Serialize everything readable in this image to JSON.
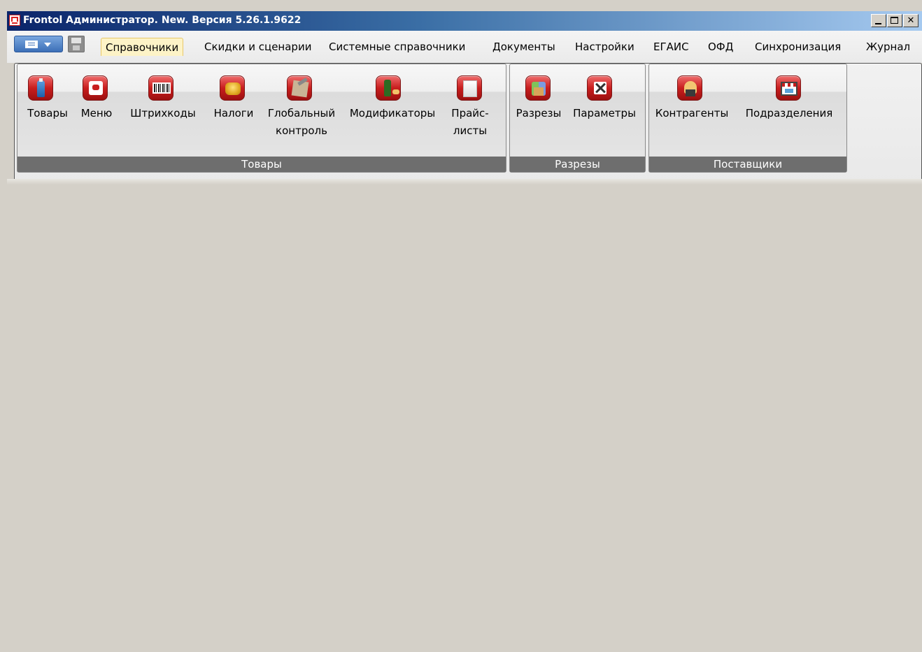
{
  "window": {
    "title": "Frontol Администратор. New. Версия 5.26.1.9622"
  },
  "menubar": {
    "tabs": [
      {
        "label": "Справочники",
        "active": true
      },
      {
        "label": "Скидки и сценарии",
        "active": false
      },
      {
        "label": "Системные справочники",
        "active": false
      },
      {
        "label": "Документы",
        "active": false
      },
      {
        "label": "Настройки",
        "active": false
      },
      {
        "label": "ЕГАИС",
        "active": false
      },
      {
        "label": "ОФД",
        "active": false
      },
      {
        "label": "Синхронизация",
        "active": false
      },
      {
        "label": "Журнал",
        "active": false
      }
    ]
  },
  "ribbon": {
    "groups": [
      {
        "label": "Товары",
        "buttons": [
          {
            "label": "Товары",
            "icon": "bottle-icon"
          },
          {
            "label": "Меню",
            "icon": "menu-book-icon"
          },
          {
            "label": "Штрихкоды",
            "icon": "barcode-icon"
          },
          {
            "label": "Налоги",
            "icon": "coins-icon"
          },
          {
            "label": "Глобальный\nконтроль",
            "icon": "box-tools-icon"
          },
          {
            "label": "Модификаторы",
            "icon": "wine-bottle-icon"
          },
          {
            "label": "Прайс-\nлисты",
            "icon": "price-list-icon"
          }
        ]
      },
      {
        "label": "Разрезы",
        "buttons": [
          {
            "label": "Разрезы",
            "icon": "cubes-icon"
          },
          {
            "label": "Параметры",
            "icon": "tools-icon"
          }
        ]
      },
      {
        "label": "Поставщики",
        "buttons": [
          {
            "label": "Контрагенты",
            "icon": "worker-icon"
          },
          {
            "label": "Подразделения",
            "icon": "shop-icon"
          }
        ]
      }
    ]
  },
  "colors": {
    "workspace": "#d4d0c8",
    "title_gradient_start": "#0a246a",
    "active_tab": "#fdf3c7",
    "group_label_bar": "#6e6e6e",
    "icon_red": "#c81e1e"
  }
}
